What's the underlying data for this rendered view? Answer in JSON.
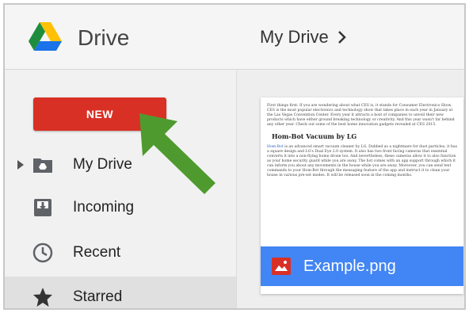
{
  "header": {
    "app_title": "Drive",
    "breadcrumb": "My Drive"
  },
  "sidebar": {
    "new_button_label": "NEW",
    "items": [
      {
        "label": "My Drive",
        "icon": "drive-folder-icon",
        "expandable": true
      },
      {
        "label": "Incoming",
        "icon": "incoming-icon"
      },
      {
        "label": "Recent",
        "icon": "clock-icon"
      },
      {
        "label": "Starred",
        "icon": "star-icon",
        "active": true
      }
    ]
  },
  "file": {
    "name": "Example.png",
    "preview": {
      "paragraph_1": "First things first: If you are wondering about what CES is, it stands for Consumer Electronics Show. CES is the most popular electronics and technology show that takes place in each year in January at the Las Vegas Convention Center. Every year it attracts a host of companies to unveil their new products which have either ground breaking technology or creativity. And this year wasn't far behind any other year. Check out some of the best home innovation gadgets revealed at CES 2015.",
      "heading": "Hom-Bot Vacuum by LG",
      "link": "Hom-Bot",
      "paragraph_2": " is an advanced smart vacuum cleaner by LG. Dubbed as a nightmare for dust particles, it has a square design and LG's Dual Eye 2.0 system. It also has two front facing cameras that essential converts it into a non-flying home drone too. And nevertheless, these cameras allow it to also function as your home security guard while you are away. The hot comes with an app support through which it can inform you about any movements in the house while you are away. Moreover, you can send text commands to your Hom-Bot through the messaging feature of the app and instruct it to clean your house in various pre-set modes. It will be released soon in the coming months."
    }
  },
  "colors": {
    "new_button": "#d93025",
    "file_bar": "#4285f4",
    "arrow": "#4e9a2e"
  }
}
